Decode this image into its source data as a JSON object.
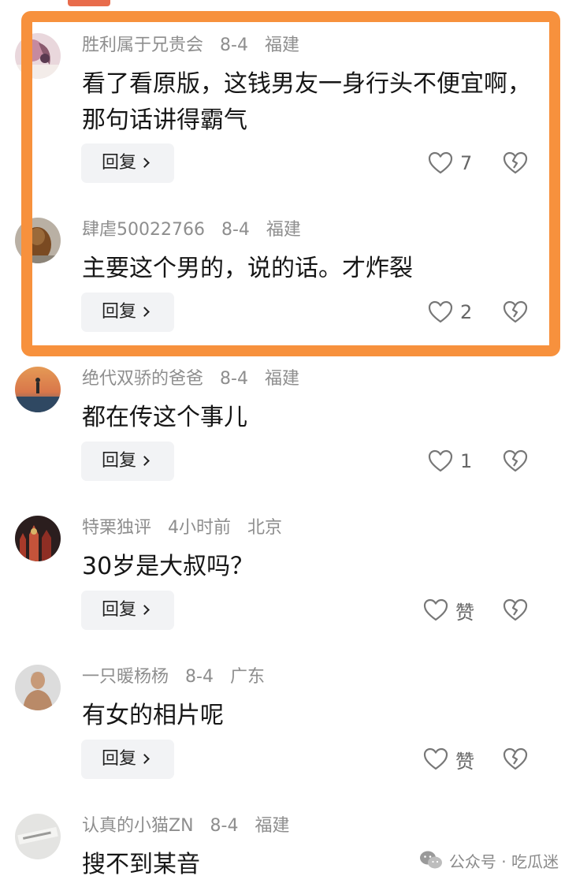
{
  "comments": [
    {
      "username": "胜利属于兄贵会",
      "date": "8-4",
      "location": "福建",
      "text": "看了看原版，这钱男友一身行头不便宜啊，那句话讲得霸气",
      "reply_label": "回复",
      "likes": "7",
      "avatar": "avatar-pink"
    },
    {
      "username": "肆虐50022766",
      "date": "8-4",
      "location": "福建",
      "text": "主要这个男的，说的话。才炸裂",
      "reply_label": "回复",
      "likes": "2",
      "avatar": "avatar-dog"
    },
    {
      "username": "绝代双骄的爸爸",
      "date": "8-4",
      "location": "福建",
      "text": "都在传这个事儿",
      "reply_label": "回复",
      "likes": "1",
      "avatar": "avatar-sunset"
    },
    {
      "username": "特栗独评",
      "date": "4小时前",
      "location": "北京",
      "text": "30岁是大叔吗？",
      "reply_label": "回复",
      "likes": "赞",
      "avatar": "avatar-castle"
    },
    {
      "username": "一只暖杨杨",
      "date": "8-4",
      "location": "广东",
      "text": "有女的相片呢",
      "reply_label": "回复",
      "likes": "赞",
      "avatar": "avatar-man"
    },
    {
      "username": "认真的小猫ZN",
      "date": "8-4",
      "location": "福建",
      "text": "搜不到某音",
      "avatar": "avatar-gray"
    }
  ],
  "watermark": {
    "label": "公众号 · 吃瓜迷"
  },
  "colors": {
    "highlight": "#f7913d",
    "reply_bg": "#f2f3f5",
    "meta_text": "#8e8e8e"
  }
}
